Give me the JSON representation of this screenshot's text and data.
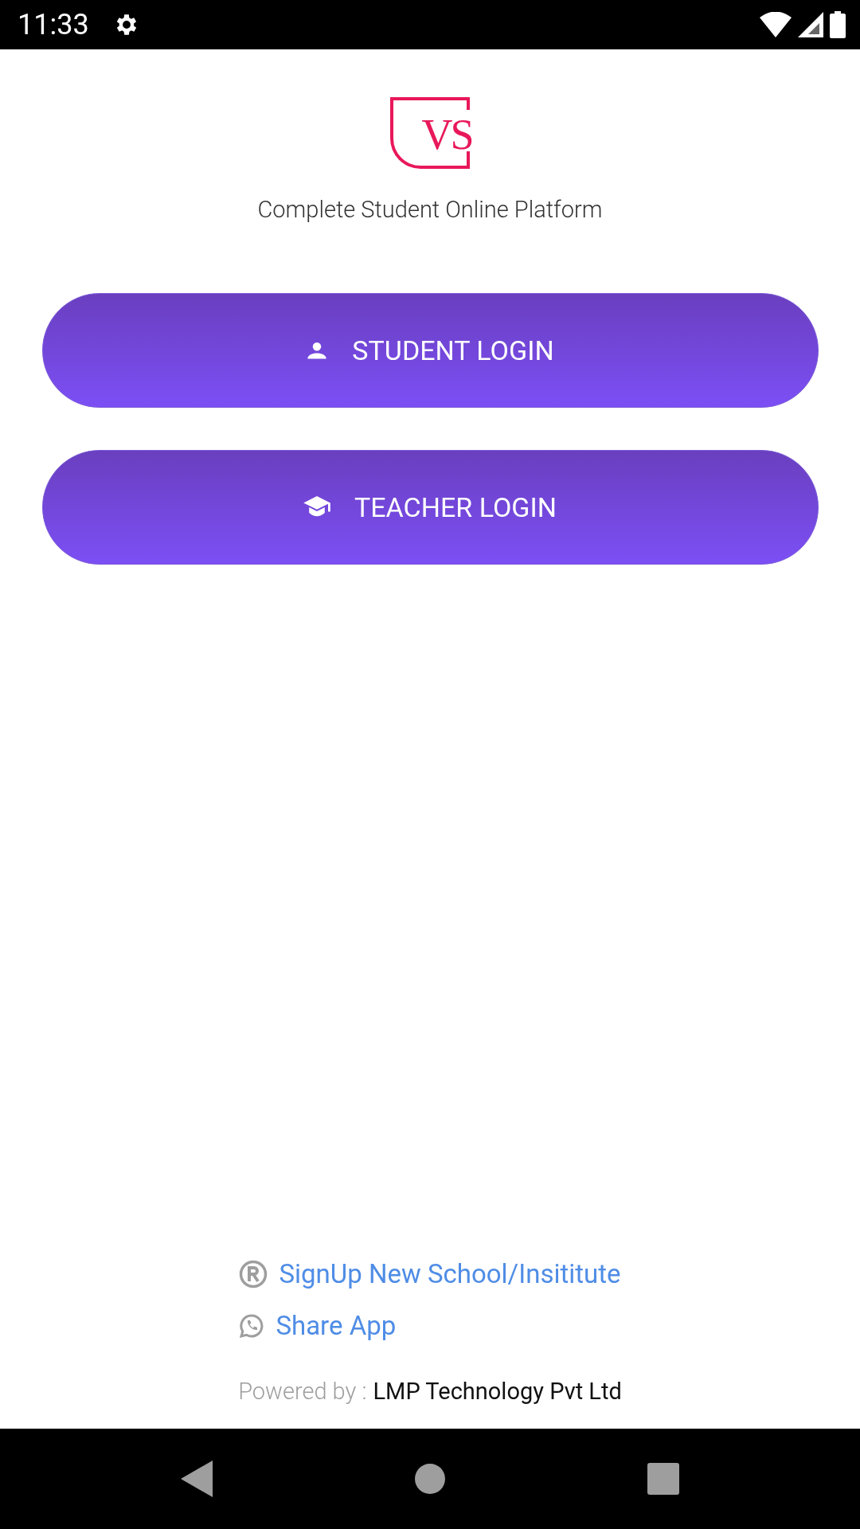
{
  "status_bar": {
    "time": "11:33"
  },
  "logo": {
    "text": "VS"
  },
  "tagline": "Complete Student Online Platform",
  "login_buttons": [
    {
      "kind": "student",
      "label": "STUDENT LOGIN"
    },
    {
      "kind": "teacher",
      "label": "TEACHER LOGIN"
    }
  ],
  "footer_links": [
    {
      "kind": "registered",
      "label": "SignUp New School/Insititute"
    },
    {
      "kind": "share",
      "label": "Share App"
    }
  ],
  "powered_by": {
    "prefix": "Powered by :",
    "company": "LMP Technology Pvt Ltd"
  }
}
